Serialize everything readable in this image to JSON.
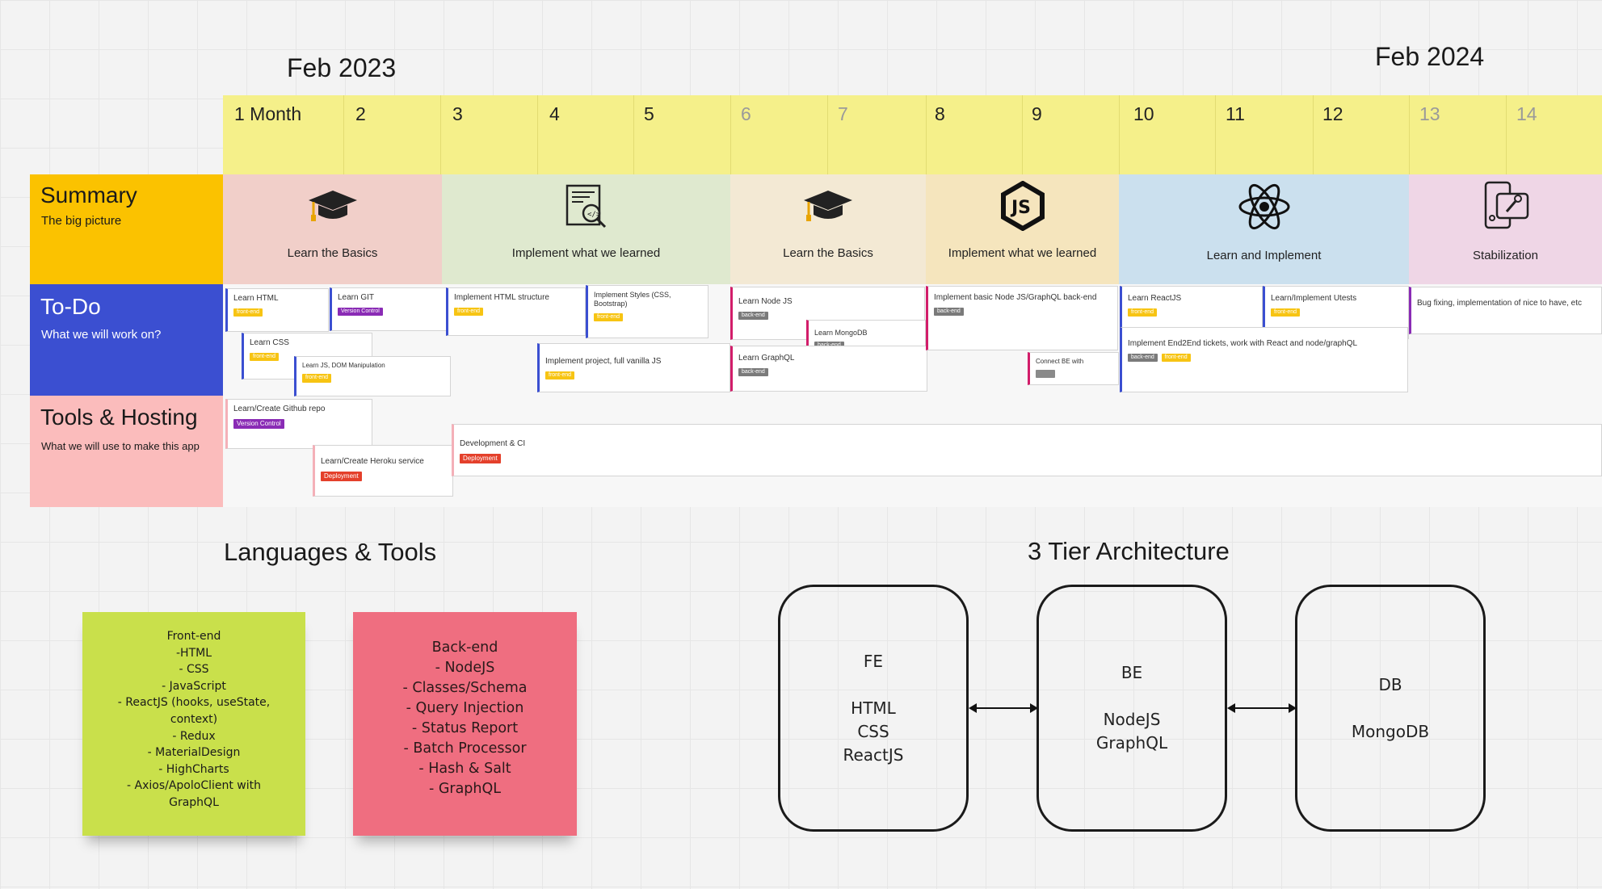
{
  "header": {
    "year_left": "Feb 2023",
    "year_right": "Feb 2024",
    "months": [
      {
        "label": "1 Month",
        "muted": false
      },
      {
        "label": "2",
        "muted": false
      },
      {
        "label": "3",
        "muted": false
      },
      {
        "label": "4",
        "muted": false
      },
      {
        "label": "5",
        "muted": false
      },
      {
        "label": "6",
        "muted": true
      },
      {
        "label": "7",
        "muted": true
      },
      {
        "label": "8",
        "muted": false
      },
      {
        "label": "9",
        "muted": false
      },
      {
        "label": "10",
        "muted": false
      },
      {
        "label": "11",
        "muted": false
      },
      {
        "label": "12",
        "muted": false
      },
      {
        "label": "13",
        "muted": true
      },
      {
        "label": "14",
        "muted": true
      }
    ]
  },
  "rows": {
    "summary": {
      "title": "Summary",
      "subtitle": "The big picture",
      "color": "#fbc200"
    },
    "todo": {
      "title": "To-Do",
      "subtitle": "What we will work on?",
      "color": "#3b4fd1"
    },
    "tools": {
      "title": "Tools & Hosting",
      "subtitle": "What we will use to make this app",
      "color": "#fbbcbc"
    }
  },
  "phases": [
    {
      "label": "Learn the Basics",
      "icon": "graduation-cap-icon",
      "color": "#f1cfc9"
    },
    {
      "label": "Implement what we learned",
      "icon": "code-document-icon",
      "color": "#dfe9cf"
    },
    {
      "label": "Learn the Basics",
      "icon": "graduation-cap-icon",
      "color": "#f3e9d4"
    },
    {
      "label": "Implement what we learned",
      "icon": "nodejs-icon",
      "color": "#f5e5bd"
    },
    {
      "label": "Learn and Implement",
      "icon": "react-atom-icon",
      "color": "#cbe0ee"
    },
    {
      "label": "Stabilization",
      "icon": "mobile-settings-icon",
      "color": "#efd6e6"
    }
  ],
  "todo_cards": [
    {
      "text": "Learn HTML",
      "tags": [
        "front-end"
      ],
      "kind": "fe"
    },
    {
      "text": "Learn GIT",
      "tags": [
        "Version Control"
      ],
      "kind": "fe"
    },
    {
      "text": "Learn CSS",
      "tags": [
        "front-end"
      ],
      "kind": "fe"
    },
    {
      "text": "Learn JS, DOM Manipulation",
      "tags": [
        "front-end"
      ],
      "kind": "fe"
    },
    {
      "text": "Implement HTML structure",
      "tags": [
        "front-end"
      ],
      "kind": "fe"
    },
    {
      "text": "Implement Styles (CSS, Bootstrap)",
      "tags": [
        "front-end"
      ],
      "kind": "fe"
    },
    {
      "text": "Implement project, full vanilla JS",
      "tags": [
        "front-end"
      ],
      "kind": "fe"
    },
    {
      "text": "Learn Node JS",
      "tags": [
        "back-end"
      ],
      "kind": "be"
    },
    {
      "text": "Learn MongoDB",
      "tags": [
        "back-end"
      ],
      "kind": "be"
    },
    {
      "text": "Learn GraphQL",
      "tags": [
        "back-end"
      ],
      "kind": "be"
    },
    {
      "text": "Implement basic Node JS/GraphQL back-end",
      "tags": [
        "back-end"
      ],
      "kind": "be"
    },
    {
      "text": "Connect BE with",
      "tags": [
        ""
      ],
      "kind": "be"
    },
    {
      "text": "Learn ReactJS",
      "tags": [
        "front-end"
      ],
      "kind": "react"
    },
    {
      "text": "Learn/Implement Utests",
      "tags": [
        "front-end"
      ],
      "kind": "react"
    },
    {
      "text": "Implement End2End tickets, work with React and node/graphQL",
      "tags": [
        "back-end",
        "front-end"
      ],
      "kind": "react"
    },
    {
      "text": "Bug fixing, implementation of nice to have, etc",
      "tags": [],
      "kind": "stab"
    }
  ],
  "tool_cards": [
    {
      "text": "Learn/Create Github repo",
      "tags": [
        "Version Control"
      ]
    },
    {
      "text": "Learn/Create Heroku service",
      "tags": [
        "Deployment"
      ]
    },
    {
      "text": "Development & CI",
      "tags": [
        "Deployment"
      ]
    }
  ],
  "languages": {
    "title": "Languages & Tools",
    "frontend": {
      "color": "#c9e04b",
      "lines": [
        "Front-end",
        "-HTML",
        "- CSS",
        "- JavaScript",
        "- ReactJS (hooks, useState,",
        "context)",
        "- Redux",
        "- MaterialDesign",
        "- HighCharts",
        "- Axios/ApoloClient with",
        "GraphQL"
      ]
    },
    "backend": {
      "color": "#ef6e80",
      "lines": [
        "Back-end",
        "- NodeJS",
        "- Classes/Schema",
        "- Query Injection",
        "- Status Report",
        "- Batch Processor",
        "- Hash & Salt",
        "- GraphQL"
      ]
    }
  },
  "architecture": {
    "title": "3 Tier Architecture",
    "tiers": [
      {
        "lines": [
          "FE",
          "",
          "HTML",
          "CSS",
          "ReactJS"
        ]
      },
      {
        "lines": [
          "BE",
          "",
          "NodeJS",
          "GraphQL"
        ]
      },
      {
        "lines": [
          "DB",
          "",
          "MongoDB"
        ]
      }
    ]
  }
}
